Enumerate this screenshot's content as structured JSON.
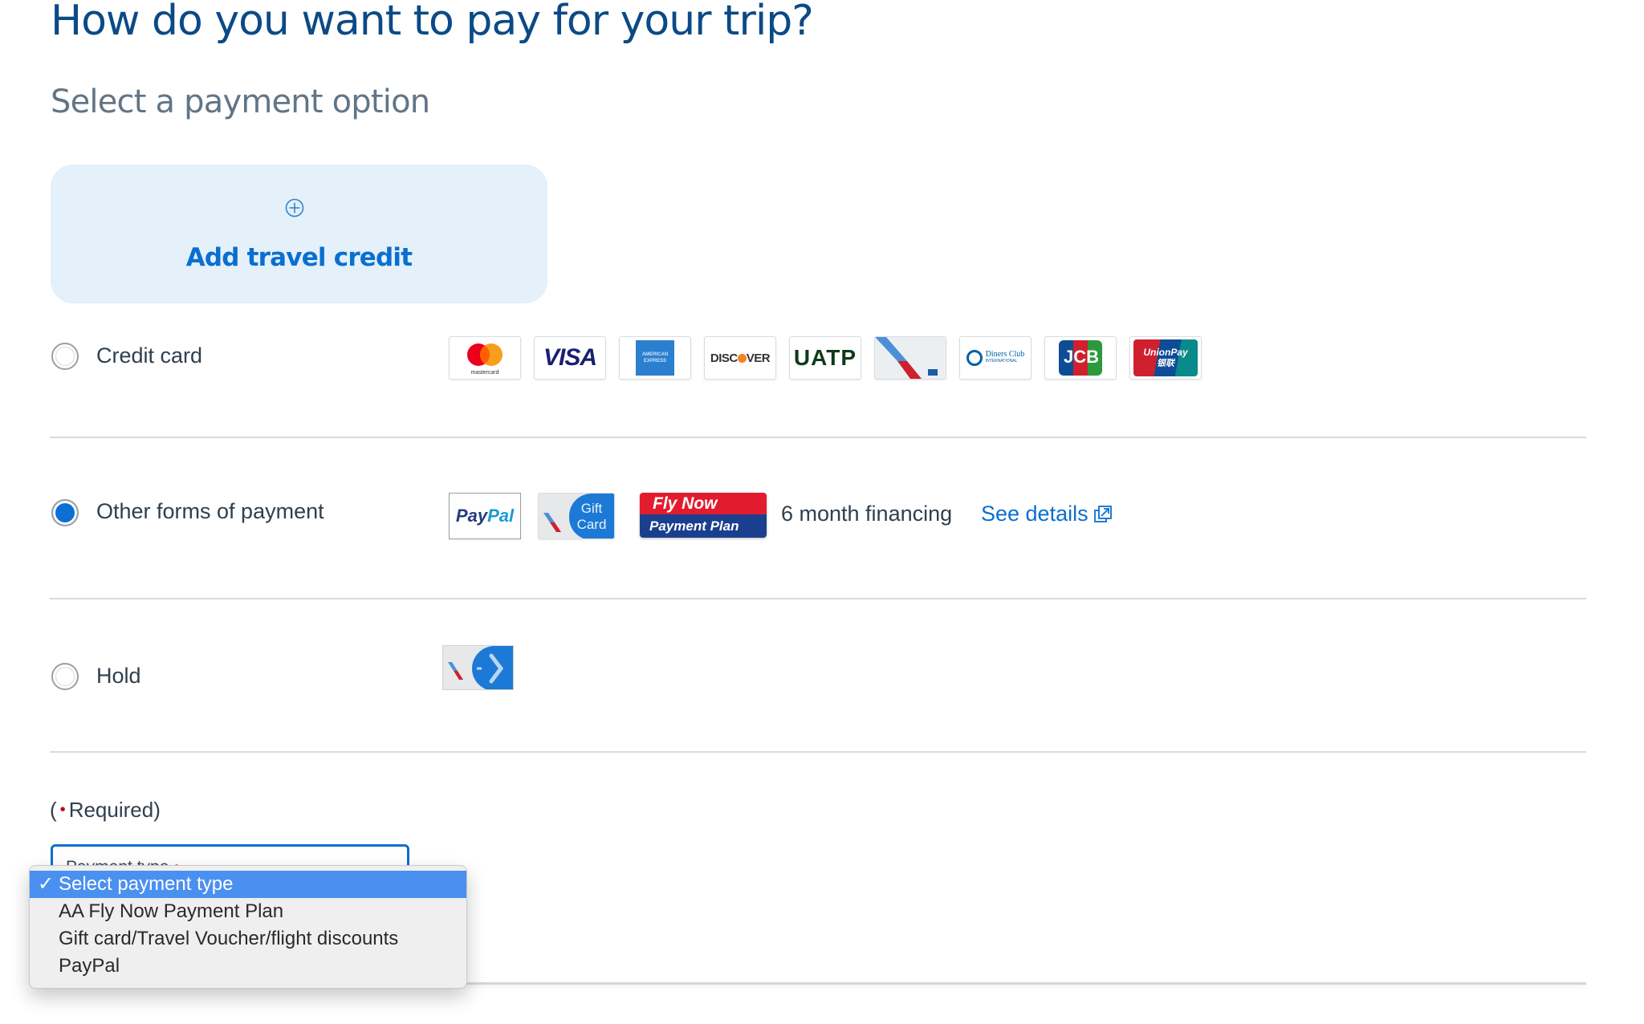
{
  "page": {
    "title": "How do you want to pay for your trip?",
    "subtitle": "Select a payment option"
  },
  "travel_credit": {
    "icon": "plus-circle-icon",
    "label": "Add travel credit"
  },
  "payment_options": [
    {
      "label": "Credit card",
      "selected": false,
      "logos": [
        "mastercard",
        "VISA",
        "American Express",
        "DISCOVER",
        "UATP",
        "AAdvantage card",
        "Diners Club International",
        "JCB",
        "UnionPay"
      ]
    },
    {
      "label": "Other forms of payment",
      "selected": true,
      "logos": [
        "PayPal",
        "Gift Card",
        "Fly Now Payment Plan"
      ],
      "financing_text": "6 month financing",
      "see_details_label": "See details",
      "see_details_icon": "external-link-icon"
    },
    {
      "label": "Hold",
      "selected": false,
      "logos": [
        "hold-clock"
      ]
    }
  ],
  "logo_text": {
    "mastercard": "mastercard",
    "visa": "VISA",
    "amex_top": "AMERICAN",
    "amex_bottom": "EXPRESS",
    "discover_a": "DISC",
    "discover_b": "VER",
    "uatp": "UATP",
    "diners_a": "Diners Club",
    "diners_b": "INTERNATIONAL",
    "jcb": "JCB",
    "unionpay_a": "UnionPay",
    "unionpay_b": "银联",
    "paypal_a": "Pay",
    "paypal_b": "Pal",
    "gift_a": "Gift",
    "gift_b": "Card",
    "flynow_a": "Fly Now",
    "flynow_b": "Payment Plan"
  },
  "required_note": {
    "open": "(",
    "dot": "•",
    "text": "Required)"
  },
  "payment_type_select": {
    "label": "Payment type",
    "required_dot": "•",
    "selected": "Select payment type",
    "options": [
      "Select payment type",
      "AA Fly Now Payment Plan",
      "Gift card/Travel Voucher/flight discounts",
      "PayPal"
    ],
    "check": "✓"
  },
  "colors": {
    "title": "#0b4a86",
    "accent": "#0a6fcf",
    "card_bg": "#e4f0fa",
    "required": "#c30019",
    "dropdown_highlight": "#4a90f0"
  }
}
